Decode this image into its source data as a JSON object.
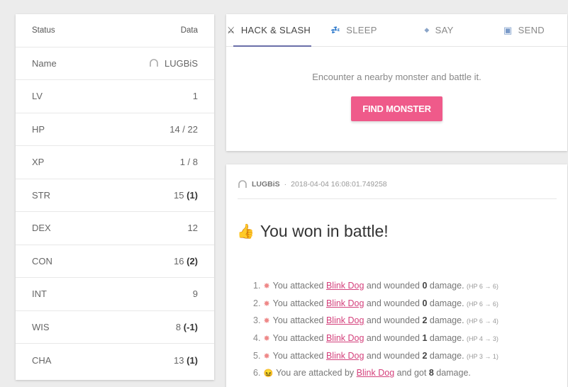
{
  "status": {
    "header_status": "Status",
    "header_data": "Data",
    "rows": [
      {
        "label": "Name",
        "value": "LUGBiS"
      },
      {
        "label": "LV",
        "value": "1"
      },
      {
        "label": "HP",
        "value": "14 / 22"
      },
      {
        "label": "XP",
        "value": "1 / 8"
      },
      {
        "label": "STR",
        "value": "15",
        "bonus": "(1)"
      },
      {
        "label": "DEX",
        "value": "12"
      },
      {
        "label": "CON",
        "value": "16",
        "bonus": "(2)"
      },
      {
        "label": "INT",
        "value": "9"
      },
      {
        "label": "WIS",
        "value": "8",
        "bonus": "(-1)"
      },
      {
        "label": "CHA",
        "value": "13",
        "bonus": "(1)"
      }
    ]
  },
  "tabs": [
    {
      "label": "HACK & SLASH",
      "icon": "crossed-swords-icon",
      "glyph": "⚔"
    },
    {
      "label": "SLEEP",
      "icon": "zzz-icon",
      "glyph": "💤"
    },
    {
      "label": "SAY",
      "icon": "speech-icon",
      "glyph": "◆"
    },
    {
      "label": "SEND",
      "icon": "package-icon",
      "glyph": "▣"
    }
  ],
  "action": {
    "description": "Encounter a nearby monster and battle it.",
    "button_label": "FIND MONSTER"
  },
  "log": {
    "user": "LUGBiS",
    "separator": "·",
    "timestamp": "2018-04-04 16:08:01.749258",
    "title": "You won in battle!",
    "entries": [
      {
        "num": "1.",
        "pre": "You attacked ",
        "monster": "Blink Dog",
        "mid": " and wounded ",
        "amount": "0",
        "post": " damage.",
        "hp": "(HP 6 → 6)"
      },
      {
        "num": "2.",
        "pre": "You attacked ",
        "monster": "Blink Dog",
        "mid": " and wounded ",
        "amount": "0",
        "post": " damage.",
        "hp": "(HP 6 → 6)"
      },
      {
        "num": "3.",
        "pre": "You attacked ",
        "monster": "Blink Dog",
        "mid": " and wounded ",
        "amount": "2",
        "post": " damage.",
        "hp": "(HP 6 → 4)"
      },
      {
        "num": "4.",
        "pre": "You attacked ",
        "monster": "Blink Dog",
        "mid": " and wounded ",
        "amount": "1",
        "post": " damage.",
        "hp": "(HP 4 → 3)"
      },
      {
        "num": "5.",
        "pre": "You attacked ",
        "monster": "Blink Dog",
        "mid": " and wounded ",
        "amount": "2",
        "post": " damage.",
        "hp": "(HP 3 → 1)"
      },
      {
        "num": "6.",
        "pre": "You are attacked by ",
        "monster": "Blink Dog",
        "mid": " and got ",
        "amount": "8",
        "post": " damage.",
        "hp": ""
      }
    ]
  },
  "colors": {
    "accent": "#ef5a8a",
    "tab_underline": "#6a6fa8",
    "monster_link": "#d4417c"
  }
}
